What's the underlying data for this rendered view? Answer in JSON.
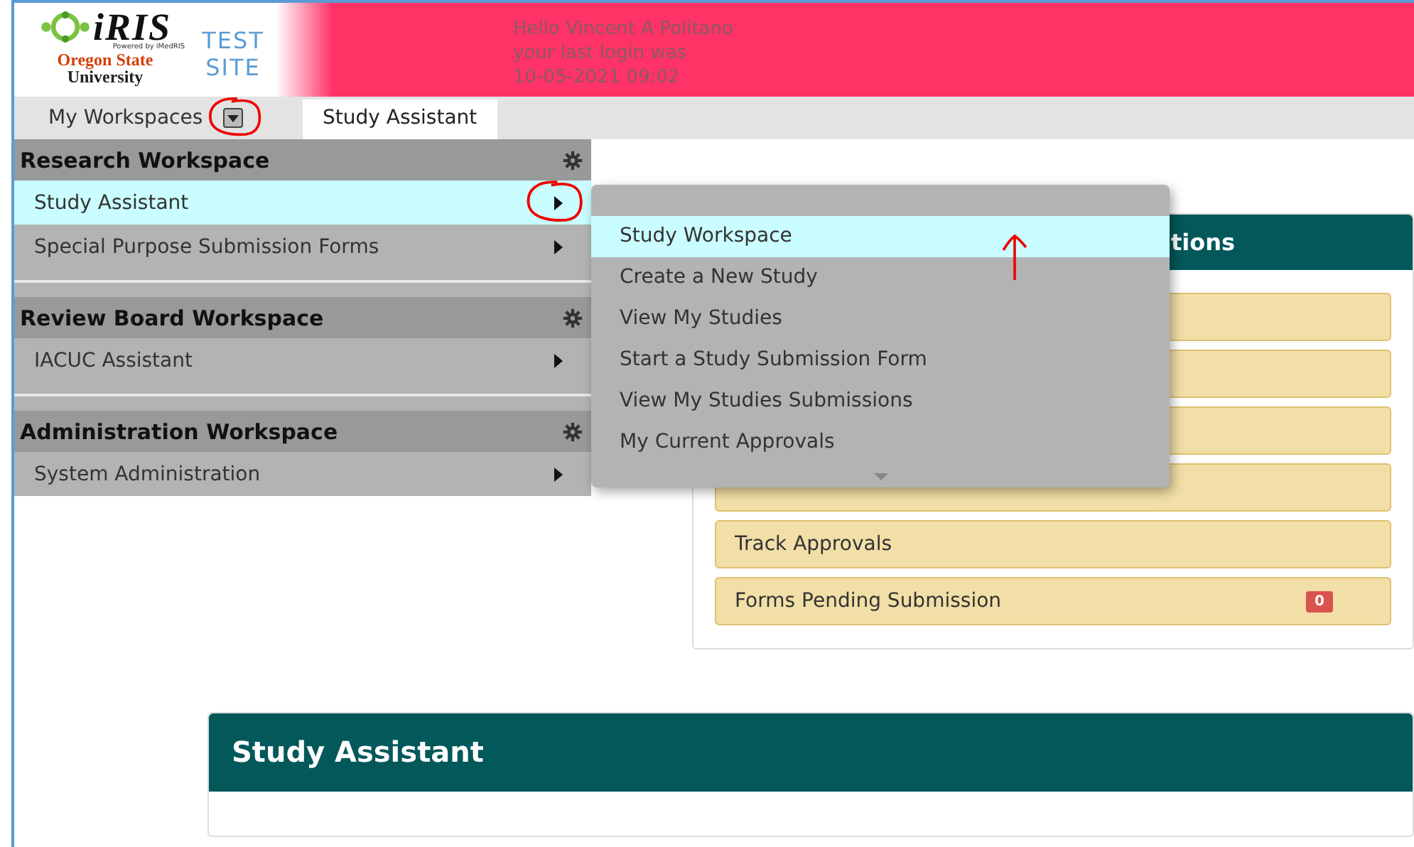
{
  "header": {
    "logo": {
      "name": "iRIS",
      "tagline": "Powered by iMedRIS",
      "institution": "Oregon State",
      "institution_sub": "University"
    },
    "site_label": "TEST SITE",
    "greeting": [
      "Hello Vincent A Politano",
      "your last login was",
      "10-05-2021 09:02"
    ]
  },
  "nav": {
    "menu_label": "My Workspaces",
    "menu_circled": true,
    "tabs": [
      {
        "label": "Study Assistant",
        "selected": true
      }
    ]
  },
  "workspace_menu": {
    "sections": [
      {
        "title": "Research Workspace",
        "items": [
          {
            "label": "Study Assistant",
            "selected": true,
            "circled": true
          },
          {
            "label": "Special Purpose Submission Forms",
            "selected": false,
            "circled": false
          }
        ]
      },
      {
        "title": "Review Board Workspace",
        "items": [
          {
            "label": "IACUC Assistant",
            "selected": false,
            "circled": false
          }
        ]
      },
      {
        "title": "Administration Workspace",
        "items": [
          {
            "label": "System Administration",
            "selected": false,
            "circled": false
          }
        ]
      }
    ]
  },
  "submenu": {
    "more_below": true,
    "items": [
      {
        "label": "Study Workspace",
        "selected": true,
        "arrow_marked": true
      },
      {
        "label": "Create a New Study",
        "selected": false,
        "arrow_marked": false
      },
      {
        "label": "View My Studies",
        "selected": false,
        "arrow_marked": false
      },
      {
        "label": "Start a Study Submission Form",
        "selected": false,
        "arrow_marked": false
      },
      {
        "label": "View My Studies Submissions",
        "selected": false,
        "arrow_marked": false
      },
      {
        "label": "My Current Approvals",
        "selected": false,
        "arrow_marked": false
      }
    ]
  },
  "actions_panel": {
    "title": "tions",
    "rows": [
      {
        "kind": "covered"
      },
      {
        "kind": "covered"
      },
      {
        "kind": "covered"
      },
      {
        "kind": "covered"
      },
      {
        "kind": "item",
        "label": "Track Approvals"
      },
      {
        "kind": "item",
        "label": "Forms Pending Submission",
        "badge": "0"
      }
    ]
  },
  "study_panel": {
    "title": "Study Assistant"
  }
}
